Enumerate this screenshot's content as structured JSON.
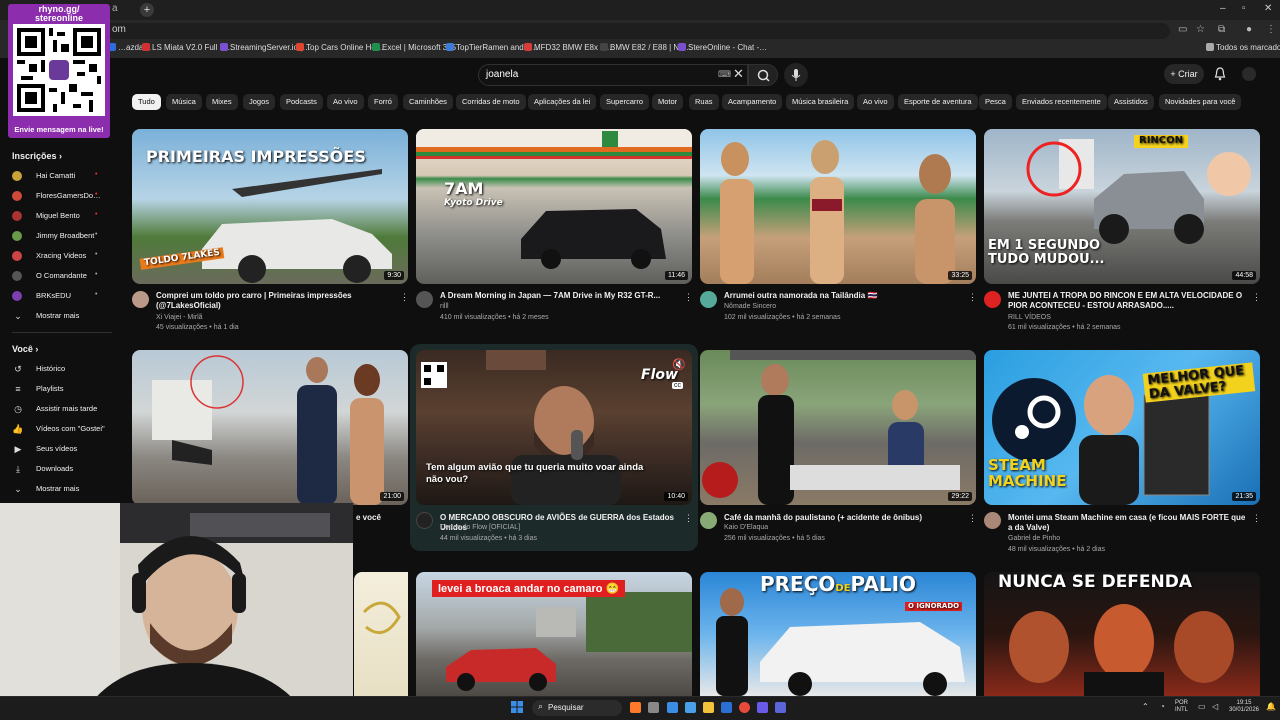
{
  "browser": {
    "new_tab": "+",
    "tab_stub": "a",
    "url_fragment": "om",
    "window_controls": [
      "–",
      "▫",
      "✕"
    ],
    "bookmarks": [
      {
        "label": "…azda…",
        "color": "#2d6cdf"
      },
      {
        "label": "LS Miata V2.0 Full B…",
        "color": "#d03030"
      },
      {
        "label": "StreamingServer.io |…",
        "color": "#7a4fd0"
      },
      {
        "label": "Top Cars Online Hor…",
        "color": "#e0462f"
      },
      {
        "label": "Excel | Microsoft 365",
        "color": "#1f8f4e"
      },
      {
        "label": "TopTierRamen and s…",
        "color": "#3e7bd6"
      },
      {
        "label": "MFD32 BMW E8x G…",
        "color": "#d83b3b"
      },
      {
        "label": "BMW E82 / E88 | No…",
        "color": "#444444"
      },
      {
        "label": "StereOnline - Chat -…",
        "color": "#7a4fd0"
      }
    ],
    "all_bookmarks": "Todos os marcadores"
  },
  "header": {
    "search_value": "joanela",
    "create_label": "Criar"
  },
  "chips": [
    "Tudo",
    "Música",
    "Mixes",
    "Jogos",
    "Podcasts",
    "Ao vivo",
    "Forró",
    "Caminhões",
    "Corridas de moto",
    "Aplicações da lei",
    "Supercarro",
    "Motor",
    "Ruas",
    "Acampamento",
    "Música brasileira",
    "Ao vivo",
    "Esporte de aventura",
    "Pesca",
    "Enviados recentemente",
    "Assistidos",
    "Novidades para você"
  ],
  "overlay": {
    "top_text_1": "rhyno.gg/",
    "top_text_2": "stereonline",
    "bottom_text": "Envie mensagem na live!"
  },
  "sidebar": {
    "subs_heading": "Inscrições",
    "subs": [
      {
        "label": "Hai Camatti",
        "color": "#c9a23a",
        "live": true
      },
      {
        "label": "FloresGamersDo…",
        "color": "#d04a3a",
        "live": true
      },
      {
        "label": "Miguel Bento",
        "color": "#a33",
        "live": true
      },
      {
        "label": "Jimmy Broadbent",
        "color": "#6a9a4a",
        "live": true
      },
      {
        "label": "Xracing Videos",
        "color": "#c44",
        "live": true
      },
      {
        "label": "O Comandante",
        "color": "#555",
        "live": true
      },
      {
        "label": "BRKsEDU",
        "color": "#7c3fb0",
        "live": true
      }
    ],
    "dot": "•",
    "show_more_1": "Mostrar mais",
    "you_heading": "Você",
    "you_items": [
      "Histórico",
      "Playlists",
      "Assistir mais tarde",
      "Vídeos com \"Gostei\"",
      "Seus vídeos",
      "Downloads",
      "Mostrar mais"
    ]
  },
  "videos": [
    {
      "title": "Comprei um toldo pro carro | Primeiras impressões (@7LakesOficial)",
      "channel": "Xi Viajei - Mirlã",
      "meta": "45 visualizações • há 1 dia",
      "duration": "9:30",
      "overlay": "PRIMEIRAS IMPRESSÕES",
      "overlay2": "TOLDO 7LAKES",
      "thumb_bg": "linear-gradient(180deg,#7ab0d8 0%,#b7d4e6 45%,#4f7a3a 70%,#6b6b5c 100%)",
      "av": "#b98"
    },
    {
      "title": "A Dream Morning in Japan — 7AM Drive in My R32 GT-R...",
      "channel": "rilll",
      "meta": "410 mil visualizações • há 2 meses",
      "duration": "11:46",
      "overlay": "7AM",
      "overlay2": "Kyoto Drive",
      "thumb_bg": "linear-gradient(180deg,#e9e2d8 0%,#d8c9b6 30%,#3a8a4a 32%,#c9c2b5 38%,#8c8c88 70%,#5f5f5c 100%)",
      "av": "#555"
    },
    {
      "title": "Arrumei outra namorada na Tailândia 🇹🇭",
      "channel": "Nômade Sincero",
      "meta": "102 mil visualizações • há 2 semanas",
      "duration": "33:25",
      "overlay": "",
      "overlay2": "",
      "thumb_bg": "linear-gradient(180deg,#8fc4e8 0%,#cfe4f0 30%,#3b8a4b 45%,#c6a07a 70%,#a37e5c 100%)",
      "av": "#5a9"
    },
    {
      "title": "ME JUNTEI A TROPA DO RINCON E EM ALTA VELOCIDADE O PIOR ACONTECEU - ESTOU ARRASADO.....",
      "channel": "RILL VÍDEOS",
      "meta": "61 mil visualizações • há 2 semanas",
      "duration": "44:58",
      "overlay": "EM 1 SEGUNDO TUDO MUDOU...",
      "overlay2": "RINCON",
      "thumb_bg": "linear-gradient(180deg,#9fb5c9 0%,#c9d4dc 40%,#7b7b78 60%,#4a4a48 100%)",
      "av": "#d22"
    },
    {
      "title": "",
      "channel": "",
      "meta": "",
      "duration": "21:00",
      "overlay": "",
      "overlay2": "",
      "thumb_bg": "linear-gradient(180deg,#b8c9d6 0%,#d2d6d6 40%,#8a8680 70%,#6a625a 100%)",
      "av": "#777",
      "title_fragment": "e você"
    },
    {
      "title": "O MERCADO OBSCURO de AVIÕES de GUERRA dos Estados Unidos",
      "channel": "Cortes do Flow [OFICIAL]",
      "meta": "44 mil visualizações • há 3 dias",
      "duration": "10:40",
      "overlay": "Tem algum avião que tu queria muito voar ainda não vou?",
      "overlay2": "Flow",
      "thumb_bg": "linear-gradient(180deg,#3a2a22 0%,#5a4030 40%,#3b2b24 70%,#1e1814 100%)",
      "av": "#222"
    },
    {
      "title": "Café da manhã do paulistano (+ acidente de ônibus)",
      "channel": "Kaio D'Elaqua",
      "meta": "256 mil visualizações • há 5 dias",
      "duration": "29:22",
      "overlay": "",
      "overlay2": "",
      "thumb_bg": "linear-gradient(180deg,#6a8a5a 0%,#8aa47a 35%,#6d6b66 60%,#8a7a66 100%)",
      "av": "#8a7"
    },
    {
      "title": "Montei uma Steam Machine em casa (e ficou MAIS FORTE que a da Valve)",
      "channel": "Gabriel de Pinho",
      "meta": "48 mil visualizações • há 2 dias",
      "duration": "21:35",
      "overlay": "STEAM MACHINE",
      "overlay2": "MELHOR QUE DA VALVE?",
      "thumb_bg": "linear-gradient(135deg,#2a9ee0 0%,#57b8f0 50%,#1a6fb5 100%)",
      "av": "#a87"
    },
    {
      "title": "",
      "channel": "",
      "meta": "",
      "duration": "",
      "overlay": "",
      "overlay2": "",
      "thumb_bg": "linear-gradient(180deg,#f3eedc 0%,#e8e0c4 100%)",
      "av": "#777"
    },
    {
      "title": "",
      "channel": "",
      "meta": "",
      "duration": "",
      "overlay": "levei a broaca andar no camaro 😁",
      "overlay2": "",
      "thumb_bg": "linear-gradient(180deg,#c7d6e4 0%,#a3a8a8 45%,#6e6b66 70%,#4d4a46 100%)",
      "av": "#777"
    },
    {
      "title": "",
      "channel": "",
      "meta": "",
      "duration": "",
      "overlay": "PREÇO",
      "overlay2": "O IGNORADO",
      "thumb_bg": "linear-gradient(180deg,#2b86d6 0%,#6cb4ec 50%,#e8e8e8 100%)",
      "av": "#777",
      "overlay3": "DE",
      "overlay4": "PALIO"
    },
    {
      "title": "",
      "channel": "",
      "meta": "",
      "duration": "",
      "overlay": "NUNCA SE DEFENDA",
      "overlay2": "",
      "thumb_bg": "linear-gradient(180deg,#151515 0%,#2a1510 50%,#8a2a1a 100%)",
      "av": "#777"
    }
  ],
  "taskbar": {
    "search_label": "Pesquisar",
    "lang_1": "POR",
    "lang_2": "INTL",
    "time": "19:15",
    "date": "30/01/2026"
  }
}
